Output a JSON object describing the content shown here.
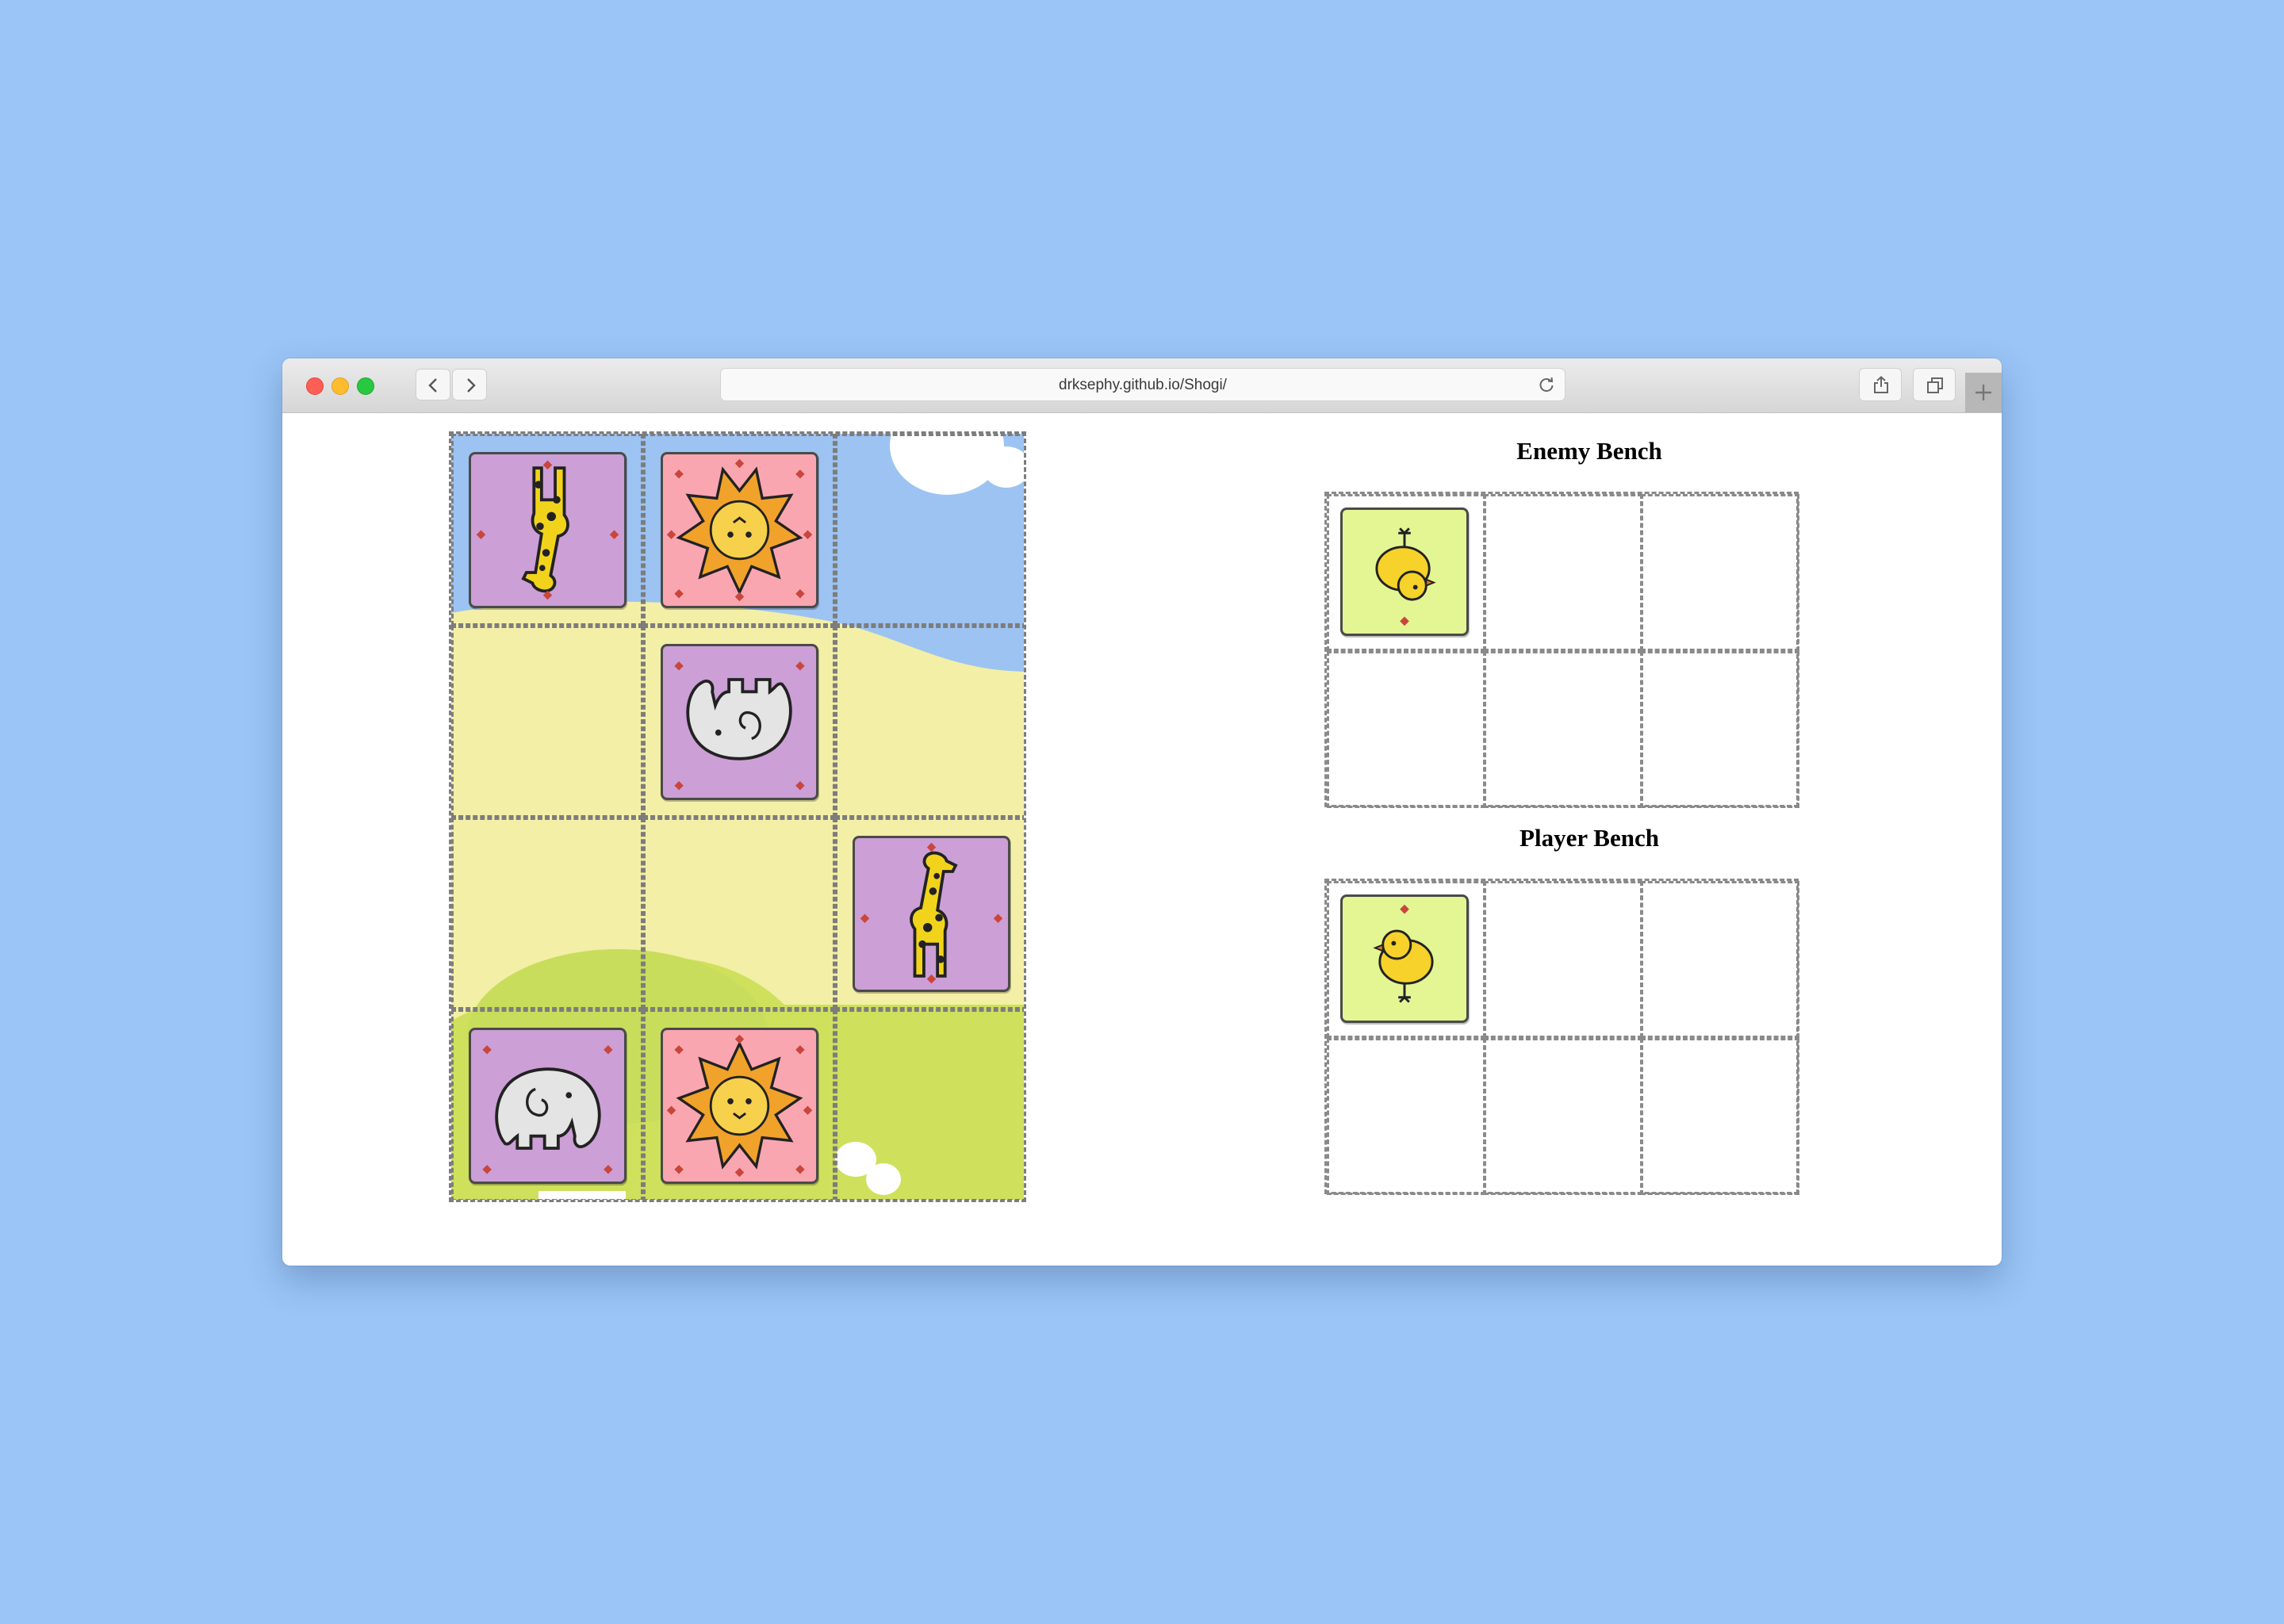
{
  "browser": {
    "url": "drksephy.github.io/Shogi/",
    "buttons": {
      "back": "chevron-left-icon",
      "forward": "chevron-right-icon",
      "reload": "reload-icon",
      "share": "share-icon",
      "tabs": "tabs-icon",
      "new_tab": "plus-icon"
    }
  },
  "board": {
    "rows": 4,
    "cols": 3,
    "background_colors": {
      "sky": "#9cc3f2",
      "sand": "#f3efa6",
      "grass": "#cfe05c",
      "cloud": "#ffffff"
    },
    "squares": [
      [
        "enemy-giraffe",
        "enemy-lion",
        "empty"
      ],
      [
        "empty",
        "enemy-elephant",
        "empty"
      ],
      [
        "empty",
        "empty",
        "player-giraffe"
      ],
      [
        "player-elephant",
        "player-lion",
        "empty"
      ]
    ]
  },
  "enemy_bench": {
    "title": "Enemy Bench",
    "slots": [
      "enemy-chick",
      "empty",
      "empty",
      "empty",
      "empty",
      "empty"
    ]
  },
  "player_bench": {
    "title": "Player Bench",
    "slots": [
      "player-chick",
      "empty",
      "empty",
      "empty",
      "empty",
      "empty"
    ]
  },
  "piece_colors": {
    "lion": "#f9a6b0",
    "giraffe": "#cc9fd6",
    "elephant": "#cc9fd6",
    "chick": "#e4f594",
    "marker": "#c9463d"
  }
}
